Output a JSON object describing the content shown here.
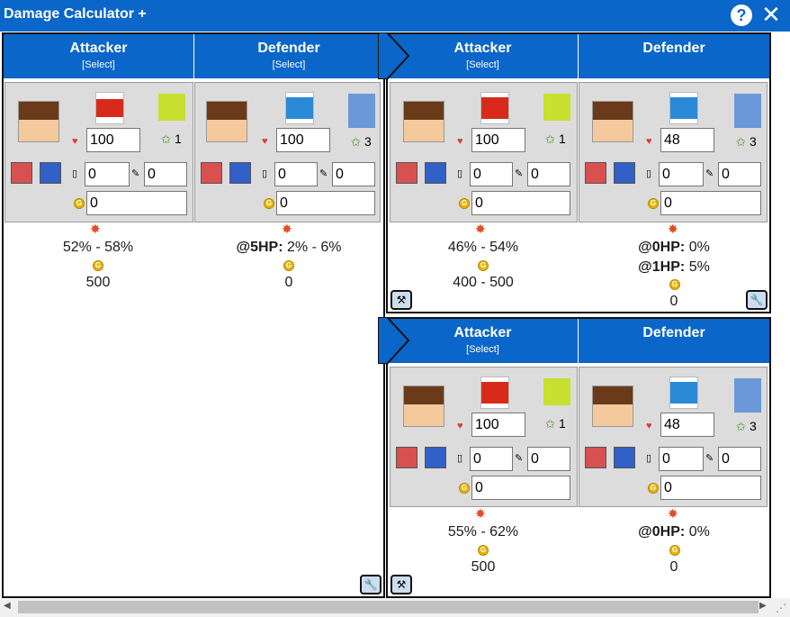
{
  "window": {
    "title": "Damage Calculator +",
    "help_label": "?",
    "close_label": "✕"
  },
  "panels": [
    {
      "attacker": {
        "title": "Attacker",
        "select": "[Select]",
        "hp": "100",
        "terrain_stars": "1",
        "tower_count": "0",
        "comm_count": "0",
        "funds": "0"
      },
      "defender": {
        "title": "Defender",
        "select": "[Select]",
        "hp": "100",
        "terrain_stars": "3",
        "tower_count": "0",
        "comm_count": "0",
        "funds": "0"
      },
      "results": {
        "attacker_damage": "52% - 58%",
        "attacker_funds": "500",
        "defender_prefix": "@5HP:",
        "defender_damage": "2% - 6%",
        "defender_funds": "0"
      }
    },
    {
      "attacker": {
        "title": "Attacker",
        "select": "[Select]",
        "hp": "100",
        "terrain_stars": "1",
        "tower_count": "0",
        "comm_count": "0",
        "funds": "0"
      },
      "defender": {
        "title": "Defender",
        "hp": "48",
        "terrain_stars": "3",
        "tower_count": "0",
        "comm_count": "0",
        "funds": "0"
      },
      "results": {
        "attacker_damage": "46% - 54%",
        "attacker_funds": "400 - 500",
        "defender_line1_prefix": "@0HP:",
        "defender_line1": "0%",
        "defender_line2_prefix": "@1HP:",
        "defender_line2": "5%",
        "defender_funds": "0"
      }
    },
    {
      "attacker": {
        "title": "Attacker",
        "select": "[Select]",
        "hp": "100",
        "terrain_stars": "1",
        "tower_count": "0",
        "comm_count": "0",
        "funds": "0"
      },
      "defender": {
        "title": "Defender",
        "hp": "48",
        "terrain_stars": "3",
        "tower_count": "0",
        "comm_count": "0",
        "funds": "0"
      },
      "results": {
        "attacker_damage": "55% - 62%",
        "attacker_funds": "500",
        "defender_prefix": "@0HP:",
        "defender_damage": "0%",
        "defender_funds": "0"
      }
    }
  ],
  "icons": {
    "coin": "G",
    "heart": "♥",
    "wrench": "🔧",
    "hammer": "⚒",
    "star": "✩"
  },
  "colors": {
    "header": "#0a66c8",
    "card": "#dcdcdc",
    "plain_tile": "#c8e030"
  }
}
